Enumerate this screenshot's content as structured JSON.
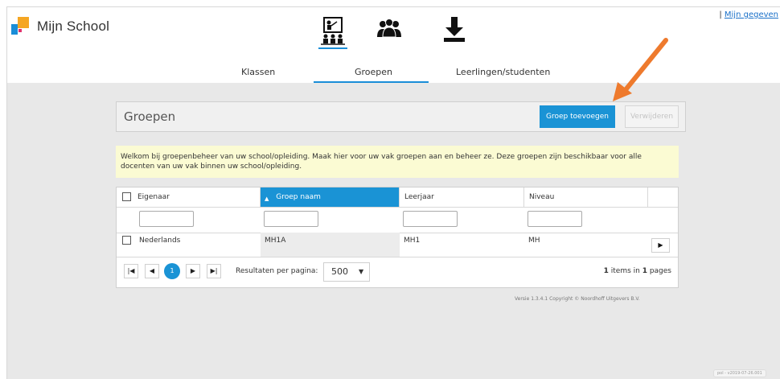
{
  "app": {
    "brand": "Mijn School",
    "top_link_prefix": "| ",
    "top_link": "Mijn gegeven"
  },
  "icons": [
    "classroom-icon",
    "group-icon",
    "download-icon"
  ],
  "tabs": [
    {
      "label": "Klassen",
      "active": false
    },
    {
      "label": "Groepen",
      "active": true
    },
    {
      "label": "Leerlingen/studenten",
      "active": false
    }
  ],
  "page": {
    "title": "Groepen",
    "add_button": "Groep toevoegen",
    "delete_button": "Verwijderen",
    "notice": "Welkom bij groepenbeheer van uw school/opleiding. Maak hier voor uw vak groepen aan en beheer ze. Deze groepen zijn beschikbaar voor alle docenten van uw vak binnen uw school/opleiding."
  },
  "table": {
    "columns": [
      "Eigenaar",
      "Groep naam",
      "Leerjaar",
      "Niveau"
    ],
    "sorted_indicator": "▲",
    "rows": [
      {
        "eigenaar": "Nederlands",
        "groep": "MH1A",
        "leerjaar": "MH1",
        "niveau": "MH",
        "action": "▶"
      }
    ]
  },
  "pager": {
    "first": "|◀",
    "prev": "◀",
    "current": "1",
    "next": "▶",
    "last": "▶|",
    "per_page_label": "Resultaten per pagina:",
    "per_page_value": "500",
    "dropdown_arrow": "▼",
    "items_count": "1",
    "items_text": " items in ",
    "pages_count": "1",
    "pages_text": " pages"
  },
  "footer": {
    "version": "Versie 1.3.4.1 Copyright © Noordhoff Uitgevers B.V.",
    "build": "pol - v2019-07-26.001"
  },
  "colors": {
    "accent": "#1a93d5",
    "notice_bg": "#fbfbd3",
    "content_bg": "#e8e8e8",
    "annotation_arrow": "#ee7a2d"
  }
}
